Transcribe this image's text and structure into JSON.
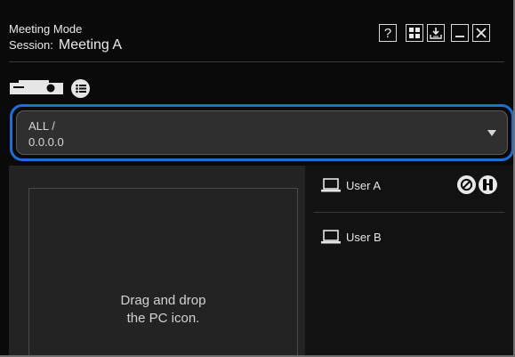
{
  "header": {
    "mode": "Meeting Mode",
    "session_label": "Session:",
    "session_value": "Meeting A"
  },
  "toolbar": {
    "help": "?",
    "buttons": [
      "help-icon",
      "grid-icon",
      "download-icon",
      "minimize-icon",
      "close-icon"
    ]
  },
  "icons": [
    "projector-icon",
    "list-icon",
    "laptop-icon",
    "stop-icon",
    "remote-control-icon"
  ],
  "group_selector": {
    "line1": "ALL /",
    "line2": "0.0.0.0"
  },
  "drop_zone": {
    "line1": "Drag and drop",
    "line2": "the PC icon."
  },
  "users": [
    {
      "name": "User A"
    },
    {
      "name": "User B"
    }
  ],
  "colors": {
    "background": "#0a0a0a",
    "accent": "#1c6fd6",
    "text": "#eaeaea"
  }
}
